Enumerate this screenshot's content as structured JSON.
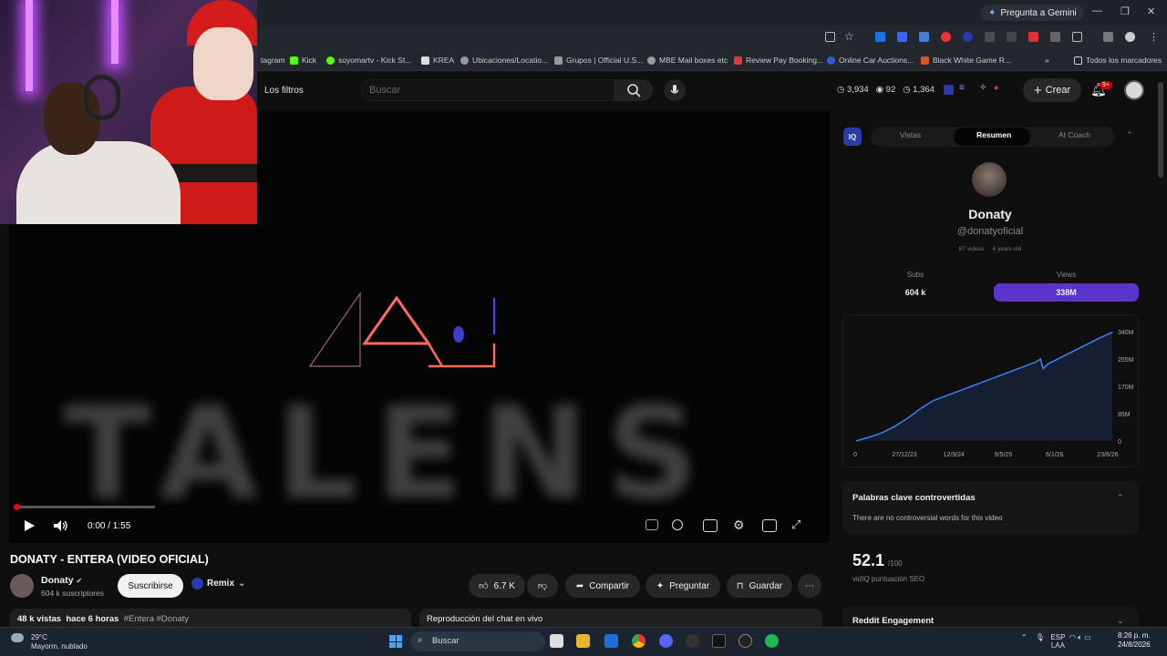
{
  "browser": {
    "gemini_label": "Pregunta a Gemini",
    "bookmarks": [
      {
        "label": "tagram",
        "color": "#c13584"
      },
      {
        "label": "Kick",
        "color": "#53fc18"
      },
      {
        "label": "soyomartv - Kick St...",
        "color": "#53fc18"
      },
      {
        "label": "KREA",
        "color": "#dddddd"
      },
      {
        "label": "Ubicaciones/Locatio...",
        "color": "#999999"
      },
      {
        "label": "Grupos | Official U.S...",
        "color": "#999999"
      },
      {
        "label": "MBE Mail boxes etc",
        "color": "#999999"
      },
      {
        "label": "Review Pay Booking...",
        "color": "#e03b3b"
      },
      {
        "label": "Online Car Auctions...",
        "color": "#2b5fd9"
      },
      {
        "label": "Black White Game R...",
        "color": "#d9532b"
      }
    ],
    "all_bookmarks": "Todos los marcadores"
  },
  "youtube": {
    "filters_label": "Los filtros",
    "search_placeholder": "Buscar",
    "header_stats": {
      "a": "3,934",
      "b": "92",
      "c": "1,364"
    },
    "create_label": "Crear",
    "notif_badge": "9+"
  },
  "player": {
    "time": "0:00 / 1:55",
    "progress_fraction": 0.0
  },
  "video": {
    "title": "DONATY - ENTERA (VIDEO OFICIAL)",
    "channel": "Donaty",
    "subscribers": "604 k suscriptores",
    "subscribe_label": "Suscribirse",
    "remix_label": "Remix",
    "likes": "6.7 K",
    "share_label": "Compartir",
    "ask_label": "Preguntar",
    "save_label": "Guardar",
    "views": "48 k vistas",
    "age": "hace 6 horas",
    "tags": "#Entera #Donaty",
    "live_chat": "Reproducción del chat en vivo"
  },
  "vidiq": {
    "badge": "IQ",
    "tabs": [
      "Vistas",
      "Resumen",
      "AI Coach"
    ],
    "active_tab": "Resumen",
    "channel_name": "Donaty",
    "handle": "@donatyoficial",
    "videos": "87 videos",
    "age": "4 years old",
    "subs_label": "Subs",
    "subs_value": "604 k",
    "views_label": "Views",
    "views_value": "338M",
    "keywords_title": "Palabras clave controvertidas",
    "keywords_text": "There are no controversial words for this video",
    "seo_score": "52.1",
    "seo_max": "/100",
    "seo_label": "vidIQ puntuación SEO",
    "reddit_title": "Reddit Engagement"
  },
  "chart_data": {
    "type": "line",
    "x": [
      "27/12/23",
      "12/9/24",
      "9/5/25",
      "6/1/26",
      "23/8/26"
    ],
    "x_first_label": "0",
    "y_ticks": [
      "340M",
      "255M",
      "170M",
      "85M",
      "0"
    ],
    "series": [
      {
        "points": [
          [
            0,
            0
          ],
          [
            0.05,
            12
          ],
          [
            0.1,
            25
          ],
          [
            0.15,
            45
          ],
          [
            0.2,
            70
          ],
          [
            0.25,
            100
          ],
          [
            0.3,
            125
          ],
          [
            0.35,
            140
          ],
          [
            0.4,
            155
          ],
          [
            0.45,
            170
          ],
          [
            0.5,
            185
          ],
          [
            0.55,
            200
          ],
          [
            0.6,
            215
          ],
          [
            0.65,
            230
          ],
          [
            0.7,
            245
          ],
          [
            0.72,
            255
          ],
          [
            0.73,
            225
          ],
          [
            0.75,
            240
          ],
          [
            0.8,
            260
          ],
          [
            0.85,
            280
          ],
          [
            0.9,
            300
          ],
          [
            0.95,
            320
          ],
          [
            1.0,
            338
          ]
        ]
      }
    ],
    "ylim": [
      0,
      340
    ],
    "color": "#3b82f6"
  },
  "taskbar": {
    "temp": "29°C",
    "weather": "Mayorm. nublado",
    "search": "Buscar",
    "lang": "ESP",
    "lang2": "LAA",
    "time": "8:26 p. m.",
    "date": "24/8/2026"
  }
}
